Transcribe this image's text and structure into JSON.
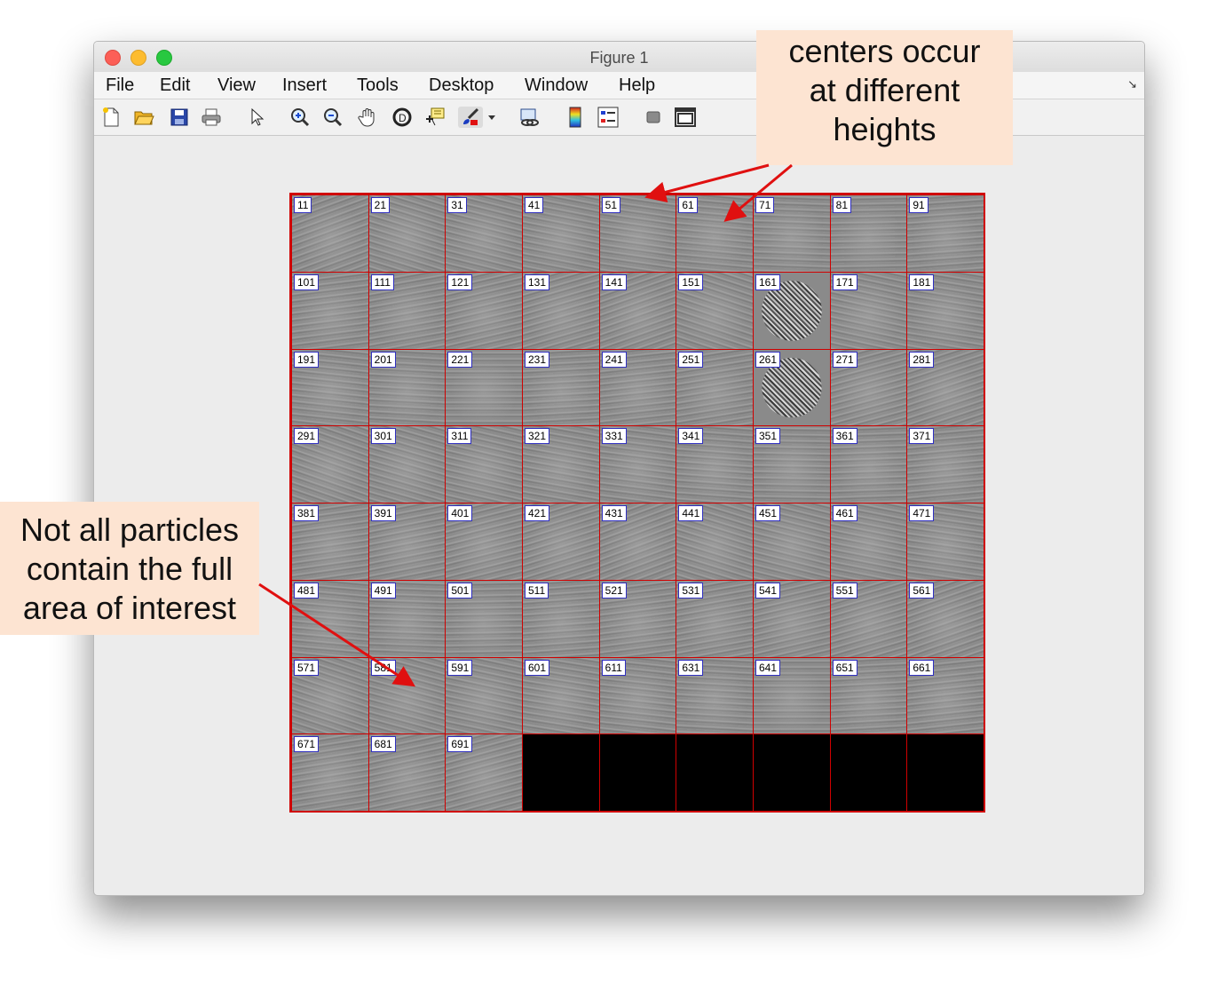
{
  "window": {
    "title": "Figure 1",
    "menu": [
      "File",
      "Edit",
      "View",
      "Insert",
      "Tools",
      "Desktop",
      "Window",
      "Help"
    ]
  },
  "toolbar": {
    "icons": [
      "new-figure-icon",
      "open-file-icon",
      "save-icon",
      "print-icon",
      "edit-plot-arrow-icon",
      "zoom-in-icon",
      "zoom-out-icon",
      "pan-hand-icon",
      "rotate-3d-icon",
      "data-cursor-icon",
      "brush-icon",
      "brush-dropdown-icon",
      "link-plot-icon",
      "colorbar-icon",
      "legend-icon",
      "hide-plot-tools-icon",
      "show-plot-tools-icon"
    ]
  },
  "montage": {
    "columns": 9,
    "rows": 8,
    "labels": [
      "11",
      "21",
      "31",
      "41",
      "51",
      "61",
      "71",
      "81",
      "91",
      "101",
      "111",
      "121",
      "131",
      "141",
      "151",
      "161",
      "171",
      "181",
      "191",
      "201",
      "221",
      "231",
      "241",
      "251",
      "261",
      "271",
      "281",
      "291",
      "301",
      "311",
      "321",
      "331",
      "341",
      "351",
      "361",
      "371",
      "381",
      "391",
      "401",
      "421",
      "431",
      "441",
      "451",
      "461",
      "471",
      "481",
      "491",
      "501",
      "511",
      "521",
      "531",
      "541",
      "551",
      "561",
      "571",
      "581",
      "591",
      "601",
      "611",
      "631",
      "641",
      "651",
      "661",
      "671",
      "681",
      "691"
    ],
    "noisy_labels": [
      "161",
      "261"
    ],
    "empty_cell_count": 6
  },
  "annotations": {
    "top_callout": [
      "centers occur",
      "at different",
      "heights"
    ],
    "left_callout": [
      "Not all particles",
      "contain the full",
      "area of interest"
    ],
    "arrow_color": "#e01010"
  }
}
